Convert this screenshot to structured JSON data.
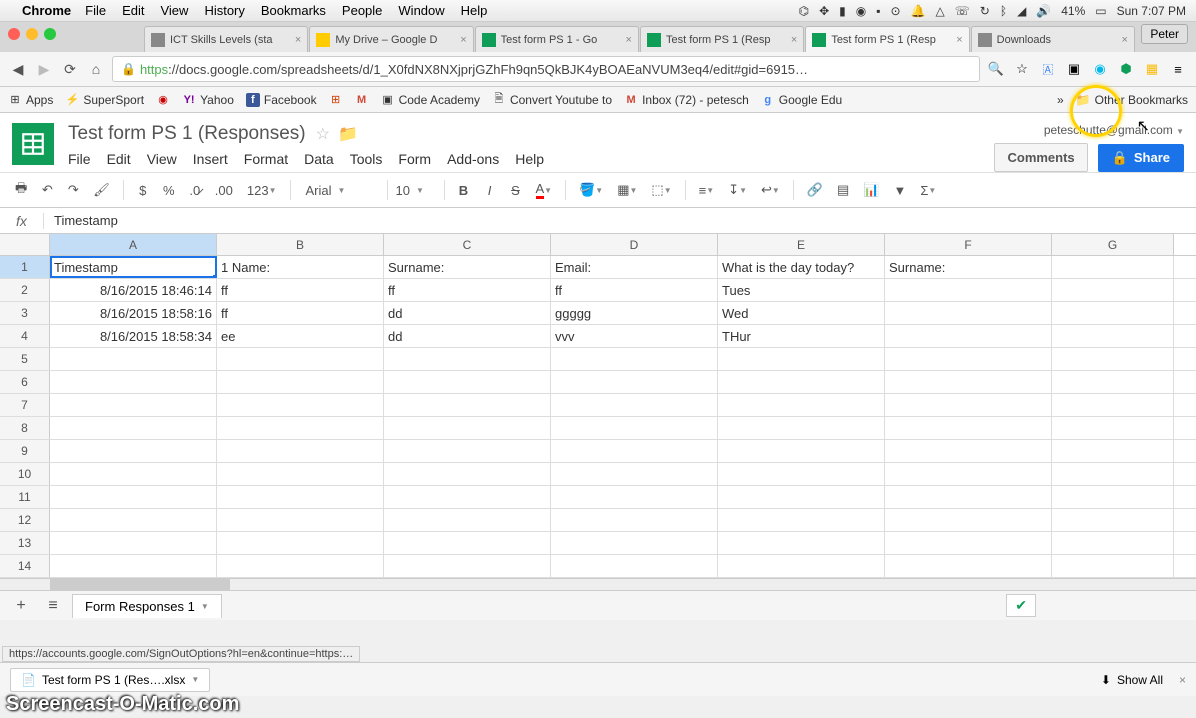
{
  "mac": {
    "app": "Chrome",
    "menus": [
      "File",
      "Edit",
      "View",
      "History",
      "Bookmarks",
      "People",
      "Window",
      "Help"
    ],
    "battery": "41%",
    "clock": "Sun 7:07 PM"
  },
  "chrome": {
    "user_badge": "Peter",
    "tabs": [
      {
        "title": "ICT Skills Levels (sta"
      },
      {
        "title": "My Drive – Google D"
      },
      {
        "title": "Test form PS 1 - Go"
      },
      {
        "title": "Test form PS 1 (Resp"
      },
      {
        "title": "Test form PS 1 (Resp"
      },
      {
        "title": "Downloads"
      }
    ],
    "active_tab": 4,
    "url_https": "https",
    "url_rest": "://docs.google.com/spreadsheets/d/1_X0fdNX8NXjprjGZhFh9qn5QkBJK4yBOAEaNVUM3eq4/edit#gid=6915…",
    "bookmarks": [
      {
        "label": "Apps",
        "icon": "⊞"
      },
      {
        "label": "SuperSport",
        "icon": "⚡"
      },
      {
        "label": "",
        "icon": "◉"
      },
      {
        "label": "Yahoo",
        "icon": "Y"
      },
      {
        "label": "Facebook",
        "icon": "f"
      },
      {
        "label": "",
        "icon": "∴"
      },
      {
        "label": "",
        "icon": "M"
      },
      {
        "label": "Code Academy",
        "icon": "▣"
      },
      {
        "label": "Convert Youtube to",
        "icon": "🗎"
      },
      {
        "label": "Inbox (72) - petesch",
        "icon": "M"
      },
      {
        "label": "Google Edu",
        "icon": "g"
      }
    ],
    "other_bookmarks": "Other Bookmarks",
    "status_link": "https://accounts.google.com/SignOutOptions?hl=en&continue=https:…",
    "download_item": "Test form PS 1  (Res….xlsx",
    "show_all": "Show All"
  },
  "sheets": {
    "title": "Test form PS 1  (Responses)",
    "email": "peteschutte@gmail.com",
    "comments": "Comments",
    "share": "Share",
    "menus": [
      "File",
      "Edit",
      "View",
      "Insert",
      "Format",
      "Data",
      "Tools",
      "Form",
      "Add-ons",
      "Help"
    ],
    "font": "Arial",
    "font_size": "10",
    "num_fmt": "123",
    "formula_label": "fx",
    "formula_value": "Timestamp",
    "columns": [
      "A",
      "B",
      "C",
      "D",
      "E",
      "F",
      "G"
    ],
    "selected_col": 0,
    "selected_row": 0,
    "headers_row": [
      "Timestamp",
      "1 Name:",
      "Surname:",
      "Email:",
      "What is the day today?",
      "Surname:",
      ""
    ],
    "data_rows": [
      [
        "8/16/2015 18:46:14",
        "ff",
        "ff",
        "ff",
        "Tues",
        "",
        ""
      ],
      [
        "8/16/2015 18:58:16",
        "ff",
        "dd",
        "ggggg",
        "Wed",
        "",
        ""
      ],
      [
        "8/16/2015 18:58:34",
        "ee",
        "dd",
        "vvv",
        "THur",
        "",
        ""
      ]
    ],
    "total_rows": 14,
    "sheet_tab": "Form Responses 1"
  },
  "watermark": "Screencast-O-Matic.com"
}
